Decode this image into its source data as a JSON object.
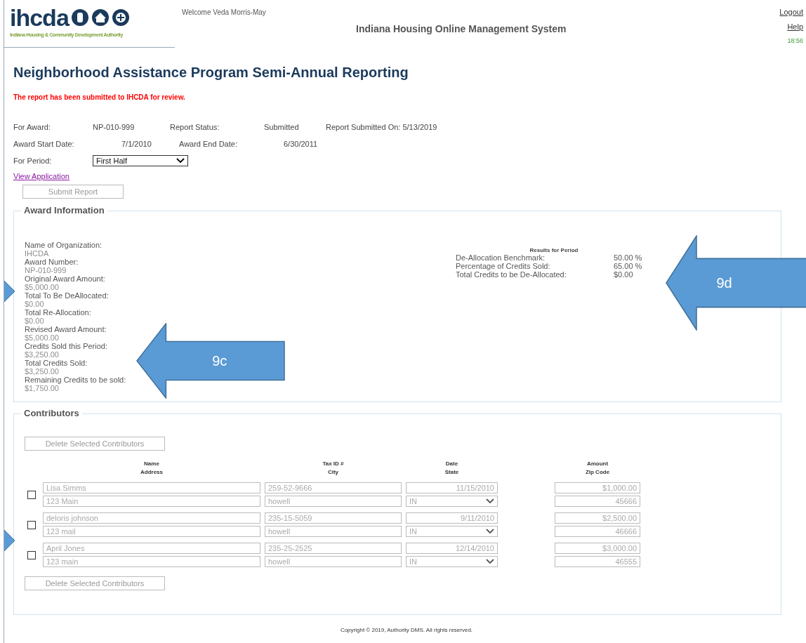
{
  "header": {
    "logo": {
      "wordmark": "ihcda",
      "tagline": "Indiana Housing & Community Development Authority"
    },
    "welcome": "Welcome Veda Morris-May",
    "system_title": "Indiana Housing Online Management System",
    "links": [
      "Logout",
      "Help"
    ],
    "time": "18:56"
  },
  "page_title": "Neighborhood Assistance Program Semi-Annual Reporting",
  "message": "The report has been submitted to IHCDA for review.",
  "details": [
    [
      {
        "label": "For Award:",
        "value": "NP-010-999"
      },
      {
        "label": "Report Status:",
        "value": "Submitted"
      },
      {
        "label": "Report Submitted On: 5/13/2019"
      }
    ],
    [
      {
        "label": "Award Start Date:",
        "value": "7/1/2010"
      },
      {
        "label": "Award End Date:",
        "value": "6/30/2011"
      }
    ]
  ],
  "period": {
    "label": "For Period:",
    "value": "First Half"
  },
  "view_application": "View Application",
  "submit_button": {
    "label": "Submit Report",
    "disabled": true
  },
  "award_information": {
    "legend": "Award Information",
    "fields": [
      {
        "label": "Name of Organization:",
        "value": "IHCDA"
      },
      {
        "label": "Award Number:",
        "value": "NP-010-999"
      },
      {
        "label": "Original Award Amount:",
        "value": "$5,000.00"
      },
      {
        "label": "Total To Be DeAllocated:",
        "value": "$0.00"
      },
      {
        "label": "Total Re-Allocation:",
        "value": "$0.00"
      },
      {
        "label": "Revised Award Amount:",
        "value": "$5,000.00"
      },
      {
        "label": "Credits Sold this Period:",
        "value": "$3,250.00"
      },
      {
        "label": "Total Credits Sold:",
        "value": "$3,250.00"
      },
      {
        "label": "Remaining Credits to be sold:",
        "value": "$1,750.00"
      }
    ],
    "results": {
      "title": "Results for Period",
      "rows": [
        {
          "label": "De-Allocation Benchmark:",
          "value": "50.00 %"
        },
        {
          "label": "Percentage of Credits Sold:",
          "value": "65.00 %"
        },
        {
          "label": "Total Credits to be De-Allocated:",
          "value": "$0.00"
        }
      ]
    }
  },
  "contributors": {
    "legend": "Contributors",
    "delete_buttons": [
      "Delete Selected Contributors",
      "Delete Selected Contributors"
    ],
    "columns": [
      [
        "Name",
        "Address"
      ],
      [
        "Tax ID #",
        "City"
      ],
      [
        "Date",
        "State"
      ],
      [
        "Amount",
        "Zip Code"
      ]
    ],
    "rows": [
      {
        "checked": false,
        "name": "Lisa Simms",
        "address": "123 Main",
        "tax_id": "259-52-9666",
        "city": "howell",
        "date": "11/15/2010",
        "state": "IN",
        "amount": "$1,000.00",
        "zip": "45666"
      },
      {
        "checked": false,
        "name": "deloris johnson",
        "address": "123 mail",
        "tax_id": "235-15-5059",
        "city": "howell",
        "date": "9/11/2010",
        "state": "IN",
        "amount": "$2,500.00",
        "zip": "46666"
      },
      {
        "checked": false,
        "name": "April Jones",
        "address": "123 main",
        "tax_id": "235-25-2525",
        "city": "howell",
        "date": "12/14/2010",
        "state": "IN",
        "amount": "$3,000.00",
        "zip": "46555"
      }
    ]
  },
  "copyright": "Copyright © 2019, Authority DMS. All rights reserved.",
  "callouts": [
    {
      "label": "9c"
    },
    {
      "label": "9d"
    }
  ]
}
